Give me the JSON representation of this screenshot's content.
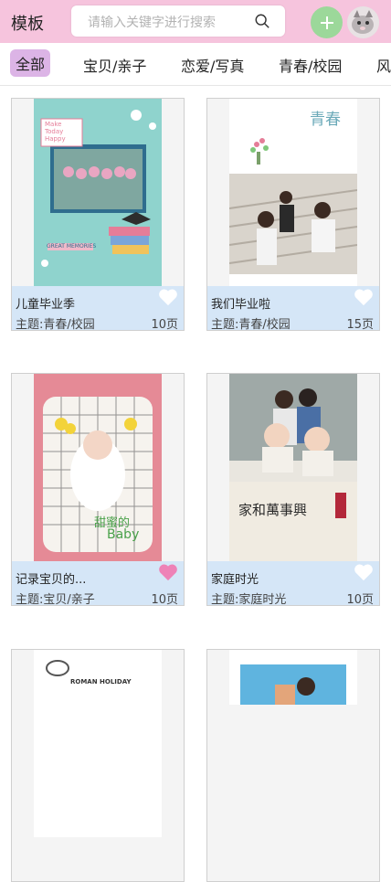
{
  "header": {
    "title": "模板",
    "search_placeholder": "请输入关键字进行搜索"
  },
  "tabs": [
    {
      "label": "全部",
      "active": true
    },
    {
      "label": "宝贝/亲子",
      "active": false
    },
    {
      "label": "恋爱/写真",
      "active": false
    },
    {
      "label": "青春/校园",
      "active": false
    },
    {
      "label": "风",
      "active": false
    }
  ],
  "cards": [
    {
      "title": "儿童毕业季",
      "theme": "主题:青春/校园",
      "pages": "10页",
      "liked": false,
      "thumb_text": [
        "Make",
        "Today",
        "Happy",
        "GREAT MEMORIES"
      ]
    },
    {
      "title": "我们毕业啦",
      "theme": "主题:青春/校园",
      "pages": "15页",
      "liked": false,
      "thumb_text": [
        "青春"
      ]
    },
    {
      "title": "记录宝贝的...",
      "theme": "主题:宝贝/亲子",
      "pages": "10页",
      "liked": true,
      "thumb_text": [
        "甜蜜的",
        "Baby"
      ]
    },
    {
      "title": "家庭时光",
      "theme": "主题:家庭时光",
      "pages": "10页",
      "liked": false,
      "thumb_text": [
        "家和萬事興"
      ]
    },
    {
      "thumb_text": [
        "ROMAN HOLIDAY"
      ]
    },
    {
      "thumb_text": []
    }
  ],
  "colors": {
    "header_bg": "#f6c4dd",
    "tab_active_bg": "#dcb4e6",
    "card_info_bg": "#d5e6f7",
    "heart_liked": "#ee82b7",
    "heart_default": "#ffffff",
    "add_button_bg": "#9cd89a"
  }
}
